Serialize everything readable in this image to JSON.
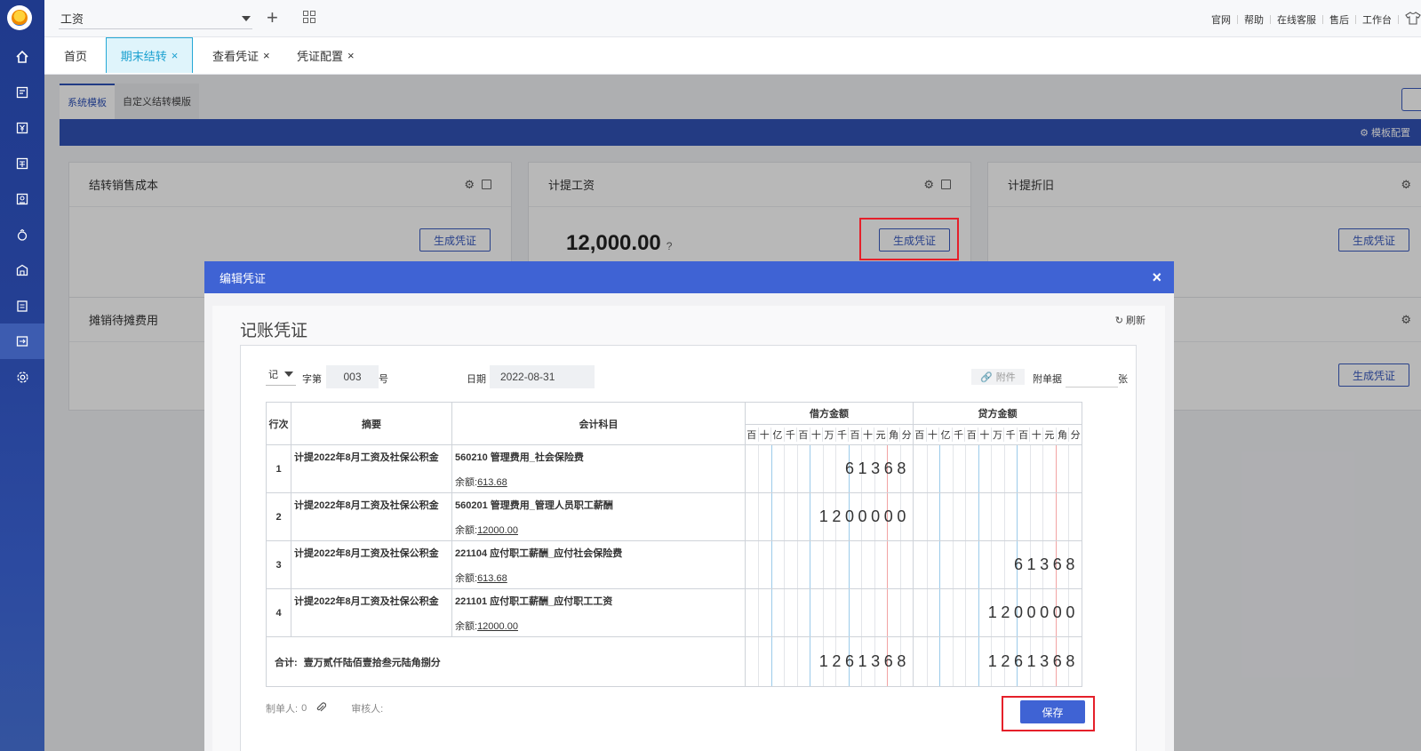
{
  "topbar": {
    "book_name": "工资",
    "links": [
      "官网",
      "帮助",
      "在线客服",
      "售后",
      "工作台"
    ]
  },
  "tabs": [
    {
      "label": "首页",
      "closable": false
    },
    {
      "label": "期末结转",
      "closable": true,
      "active": true
    },
    {
      "label": "查看凭证",
      "closable": true
    },
    {
      "label": "凭证配置",
      "closable": true
    }
  ],
  "subtabs": [
    "系统模板",
    "自定义结转模版"
  ],
  "template_config_label": "模板配置",
  "cards": [
    {
      "title": "结转销售成本",
      "button": "生成凭证"
    },
    {
      "title": "计提工资",
      "amount": "12,000.00",
      "button": "生成凭证"
    },
    {
      "title": "计提折旧",
      "button": "生成凭证"
    },
    {
      "title": "摊销待摊费用"
    },
    {
      "button": "生成凭证"
    }
  ],
  "modal": {
    "title": "编辑凭证",
    "close": "×",
    "voucher_title": "记账凭证",
    "refresh": "刷新",
    "word": "记",
    "word_label": "字第",
    "number": "003",
    "number_suffix": "号",
    "date_label": "日期",
    "date": "2022-08-31",
    "attach": "附件",
    "attach_docs_label": "附单据",
    "attach_unit": "张",
    "table": {
      "headers": {
        "row": "行次",
        "summary": "摘要",
        "account": "会计科目",
        "debit": "借方金额",
        "credit": "贷方金额"
      },
      "digit_units": [
        "百",
        "十",
        "亿",
        "千",
        "百",
        "十",
        "万",
        "千",
        "百",
        "十",
        "元",
        "角",
        "分"
      ],
      "rows": [
        {
          "no": "1",
          "summary": "计提2022年8月工资及社保公积金",
          "account": "560210 管理费用_社会保险费",
          "balance_label": "余额:",
          "balance": "613.68",
          "debit": "61368",
          "credit": ""
        },
        {
          "no": "2",
          "summary": "计提2022年8月工资及社保公积金",
          "account": "560201 管理费用_管理人员职工薪酬",
          "balance_label": "余额:",
          "balance": "12000.00",
          "debit": "1200000",
          "credit": ""
        },
        {
          "no": "3",
          "summary": "计提2022年8月工资及社保公积金",
          "account": "221104 应付职工薪酬_应付社会保险费",
          "balance_label": "余额:",
          "balance": "613.68",
          "debit": "",
          "credit": "61368"
        },
        {
          "no": "4",
          "summary": "计提2022年8月工资及社保公积金",
          "account": "221101 应付职工薪酬_应付职工工资",
          "balance_label": "余额:",
          "balance": "12000.00",
          "debit": "",
          "credit": "1200000"
        }
      ],
      "total_label": "合计:",
      "total_words": "壹万贰仟陆佰壹拾叁元陆角捌分",
      "total_debit": "1261368",
      "total_credit": "1261368"
    },
    "maker_label": "制单人:",
    "maker": "0",
    "reviewer_label": "审核人:",
    "save": "保存"
  },
  "colors": {
    "sidebar": "#243f93",
    "accent": "#3f63d4",
    "highlight": "#e5202a"
  }
}
